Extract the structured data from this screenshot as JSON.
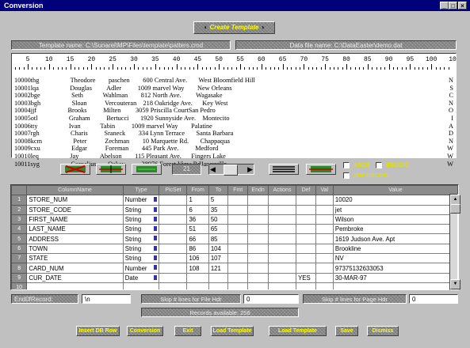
{
  "window": {
    "title": "Conversion",
    "minimize_glyph": "_",
    "maximize_glyph": "□",
    "close_glyph": "×"
  },
  "create_template_label": "Create Template",
  "template_path": "Template name: C:\\Sunarel\\MP\\Files\\template\\patters.cmd",
  "data_path": "Data file name: C:\\DataEaster\\demo.dat",
  "ruler_ticks": [
    "5",
    "10",
    "15",
    "20",
    "25",
    "30",
    "35",
    "40",
    "45",
    "50",
    "55",
    "60",
    "65",
    "70",
    "75",
    "80",
    "85",
    "90",
    "95",
    "100",
    "10"
  ],
  "records": [
    "10000thg                   Theodore        paschen        600 Central Ave.       West Bloomfield Hill",
    "10001lqa                   Douglas         Adler          1009 marvel Way        New Orleans",
    "10002bge                   Seth            Wahlman        812 North Ave.         Wagasake",
    "10003bgh                   Sloan           Vercouteran    218 Oakridge Ave.      Key West",
    "10004jjf                   Brooks          Milten         3059 Priscilla CourtSan Pedro",
    "10005otl                   Graham          Bertucci       1920 Sunnyside Ave.    Montecito",
    "10006tty                   Ivan            Tabin          1009 marvel Way        Palatine",
    "10007rgh                   Charis          Sraneck        334 Lynn Terrace       Santa Barbara",
    "10008kcm                   Peter           Zechman        10 Marquette Rd.       Chappaqua",
    "10009cxu                   Edgar           Foreman        445 Park Ave.          Medford",
    "10010leq                   Jay             Abelson        115 Pleasant Ave.      Fingers Lake",
    "10011syg                   Cornelius       Oakey          38976 Forest View RdJanesville"
  ],
  "records_right": [
    "N",
    "S",
    "C",
    "N",
    "O",
    "I",
    "A",
    "D",
    "N",
    "W",
    "W",
    "W"
  ],
  "toolbar": {
    "counter_value": "21",
    "checks": {
      "ascii": "ASCII",
      "ebcdic": "EBCDIC",
      "ibm_ebcdic": "IBM EBCDIC"
    }
  },
  "grid": {
    "headers": [
      "ColumnName",
      "Type",
      "PicSet",
      "From",
      "To",
      "Fmt",
      "Endn",
      "Actions",
      "Def",
      "Val",
      "Value"
    ],
    "rows": [
      {
        "n": "1",
        "name": "STORE_NUM",
        "type": "Number",
        "pic": "",
        "from": "1",
        "to": "5",
        "fmt": "",
        "endn": "",
        "actions": "",
        "def": "",
        "val": "",
        "value": "10020"
      },
      {
        "n": "2",
        "name": "STORE_CODE",
        "type": "String",
        "pic": "",
        "from": "6",
        "to": "35",
        "fmt": "",
        "endn": "",
        "actions": "",
        "def": "",
        "val": "",
        "value": "jet"
      },
      {
        "n": "3",
        "name": "FIRST_NAME",
        "type": "String",
        "pic": "",
        "from": "36",
        "to": "50",
        "fmt": "",
        "endn": "",
        "actions": "",
        "def": "",
        "val": "",
        "value": "Wilson"
      },
      {
        "n": "4",
        "name": "LAST_NAME",
        "type": "String",
        "pic": "",
        "from": "51",
        "to": "65",
        "fmt": "",
        "endn": "",
        "actions": "",
        "def": "",
        "val": "",
        "value": "Pembroke"
      },
      {
        "n": "5",
        "name": "ADDRESS",
        "type": "String",
        "pic": "",
        "from": "66",
        "to": "85",
        "fmt": "",
        "endn": "",
        "actions": "",
        "def": "",
        "val": "",
        "value": "1619 Judson Ave. Apt"
      },
      {
        "n": "6",
        "name": "TOWN",
        "type": "String",
        "pic": "",
        "from": "86",
        "to": "104",
        "fmt": "",
        "endn": "",
        "actions": "",
        "def": "",
        "val": "",
        "value": "Brookline"
      },
      {
        "n": "7",
        "name": "STATE",
        "type": "String",
        "pic": "",
        "from": "106",
        "to": "107",
        "fmt": "",
        "endn": "",
        "actions": "",
        "def": "",
        "val": "",
        "value": "NV"
      },
      {
        "n": "8",
        "name": "CARD_NUM",
        "type": "Number",
        "pic": "",
        "from": "108",
        "to": "121",
        "fmt": "",
        "endn": "",
        "actions": "",
        "def": "",
        "val": "",
        "value": "97375132633053"
      },
      {
        "n": "9",
        "name": "CUR_DATE",
        "type": "Date",
        "pic": "",
        "from": "",
        "to": "",
        "fmt": "",
        "endn": "",
        "actions": "",
        "def": "YES",
        "val": "",
        "value": "30-MAR-97"
      },
      {
        "n": "10",
        "name": "",
        "type": "",
        "pic": "",
        "from": "",
        "to": "",
        "fmt": "",
        "endn": "",
        "actions": "",
        "def": "",
        "val": "",
        "value": ""
      }
    ]
  },
  "options": {
    "end_of_record_label": "End0fRecord:",
    "end_of_record_value": "\\n",
    "skip_file_label": "Skip # lines for File Hdr",
    "skip_file_value": "0",
    "skip_page_label": "Skip # lines for Page Hdr",
    "skip_page_value": "0",
    "records_available": "Records available: 256"
  },
  "bottom_buttons": [
    "Insert DB Row",
    "Conversion",
    "Exit",
    "Load Template",
    "Load Template",
    "Save",
    "Dismiss"
  ]
}
